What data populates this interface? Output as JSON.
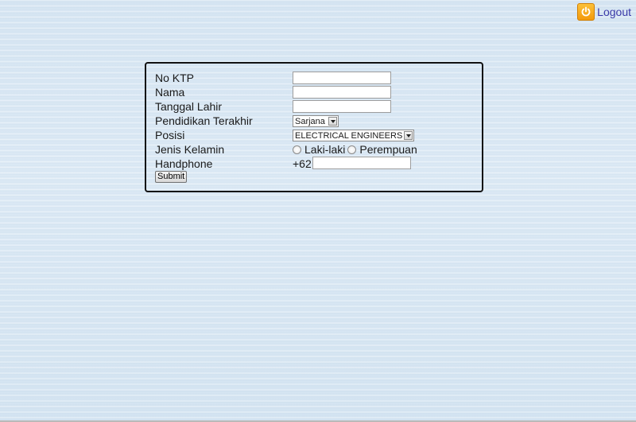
{
  "header": {
    "logout_label": "Logout",
    "logout_icon": "power-icon",
    "logout_icon_color": "#f5a916"
  },
  "form": {
    "fields": {
      "no_ktp": {
        "label": "No KTP",
        "value": ""
      },
      "nama": {
        "label": "Nama",
        "value": ""
      },
      "tanggal_lahir": {
        "label": "Tanggal Lahir",
        "value": ""
      },
      "pendidikan": {
        "label": "Pendidikan Terakhir",
        "selected": "Sarjana"
      },
      "posisi": {
        "label": "Posisi",
        "selected": "ELECTRICAL ENGINEERS"
      },
      "jenis_kelamin": {
        "label": "Jenis Kelamin",
        "options": [
          "Laki-laki",
          "Perempuan"
        ]
      },
      "handphone": {
        "label": "Handphone",
        "prefix": "+62",
        "value": ""
      }
    },
    "submit_label": "Submit"
  }
}
